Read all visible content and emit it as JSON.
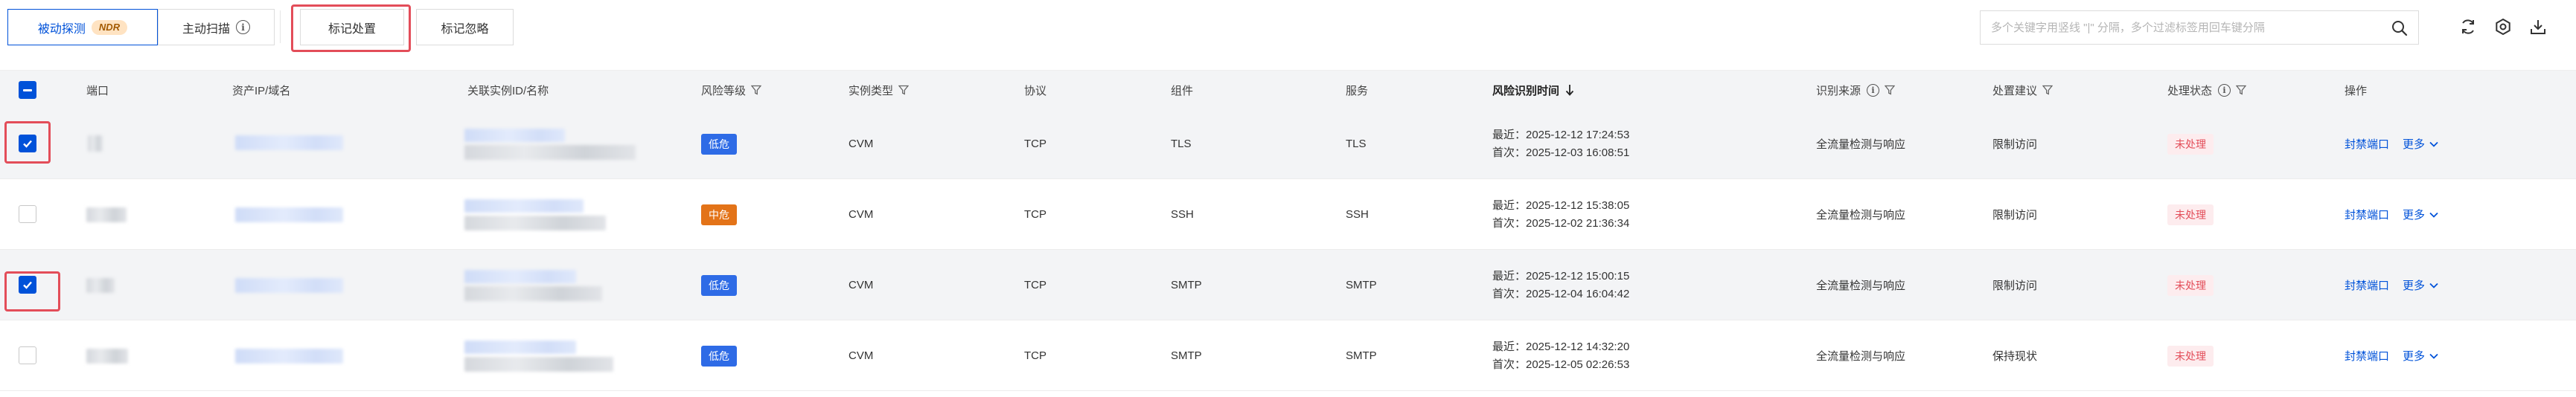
{
  "toolbar": {
    "tabs": [
      {
        "label": "被动探测",
        "badge": "NDR",
        "active": true
      },
      {
        "label": "主动扫描",
        "info": true,
        "active": false
      }
    ],
    "actions": [
      {
        "label": "标记处置",
        "highlighted": true
      },
      {
        "label": "标记忽略",
        "highlighted": false
      }
    ],
    "search": {
      "placeholder": "多个关键字用竖线 \"|\" 分隔，多个过滤标签用回车键分隔",
      "value": ""
    },
    "icons": [
      "search-icon",
      "refresh-icon",
      "settings-icon",
      "download-icon"
    ]
  },
  "table": {
    "columns": [
      {
        "label": "端口",
        "filter": false,
        "info": false
      },
      {
        "label": "资产IP/域名",
        "filter": false,
        "info": false
      },
      {
        "label": "关联实例ID/名称",
        "filter": false,
        "info": false
      },
      {
        "label": "风险等级",
        "filter": true,
        "info": false
      },
      {
        "label": "实例类型",
        "filter": true,
        "info": false
      },
      {
        "label": "协议",
        "filter": false,
        "info": false
      },
      {
        "label": "组件",
        "filter": false,
        "info": false
      },
      {
        "label": "服务",
        "filter": false,
        "info": false
      },
      {
        "label": "风险识别时间",
        "filter": false,
        "info": false,
        "sort": "desc"
      },
      {
        "label": "识别来源",
        "filter": true,
        "info": true
      },
      {
        "label": "处置建议",
        "filter": true,
        "info": false
      },
      {
        "label": "处理状态",
        "filter": true,
        "info": true
      },
      {
        "label": "操作",
        "filter": false,
        "info": false
      }
    ],
    "rows": [
      {
        "checked": true,
        "highlighted": true,
        "risk": "低危",
        "risk_level": "low",
        "instance_type": "CVM",
        "protocol": "TCP",
        "component": "TLS",
        "service": "TLS",
        "latest": "最近：2025-12-12 17:24:53",
        "first": "首次：2025-12-03 16:08:51",
        "source": "全流量检测与响应",
        "advice": "限制访问",
        "status": "未处理",
        "action": "封禁端口",
        "more": "更多"
      },
      {
        "checked": false,
        "highlighted": false,
        "risk": "中危",
        "risk_level": "mid",
        "instance_type": "CVM",
        "protocol": "TCP",
        "component": "SSH",
        "service": "SSH",
        "latest": "最近：2025-12-12 15:38:05",
        "first": "首次：2025-12-02 21:36:34",
        "source": "全流量检测与响应",
        "advice": "限制访问",
        "status": "未处理",
        "action": "封禁端口",
        "more": "更多"
      },
      {
        "checked": true,
        "highlighted": true,
        "risk": "低危",
        "risk_level": "low",
        "instance_type": "CVM",
        "protocol": "TCP",
        "component": "SMTP",
        "service": "SMTP",
        "latest": "最近：2025-12-12 15:00:15",
        "first": "首次：2025-12-04 16:04:42",
        "source": "全流量检测与响应",
        "advice": "限制访问",
        "status": "未处理",
        "action": "封禁端口",
        "more": "更多"
      },
      {
        "checked": false,
        "highlighted": false,
        "risk": "低危",
        "risk_level": "low",
        "instance_type": "CVM",
        "protocol": "TCP",
        "component": "SMTP",
        "service": "SMTP",
        "latest": "最近：2025-12-12 14:32:20",
        "first": "首次：2025-12-05 02:26:53",
        "source": "全流量检测与响应",
        "advice": "保持现状",
        "status": "未处理",
        "action": "封禁端口",
        "more": "更多"
      }
    ]
  },
  "colors": {
    "primary": "#0052d9",
    "low": "#2e6be6",
    "mid": "#e37318",
    "status": "#e34d59",
    "highlight_box": "#e34d59"
  }
}
